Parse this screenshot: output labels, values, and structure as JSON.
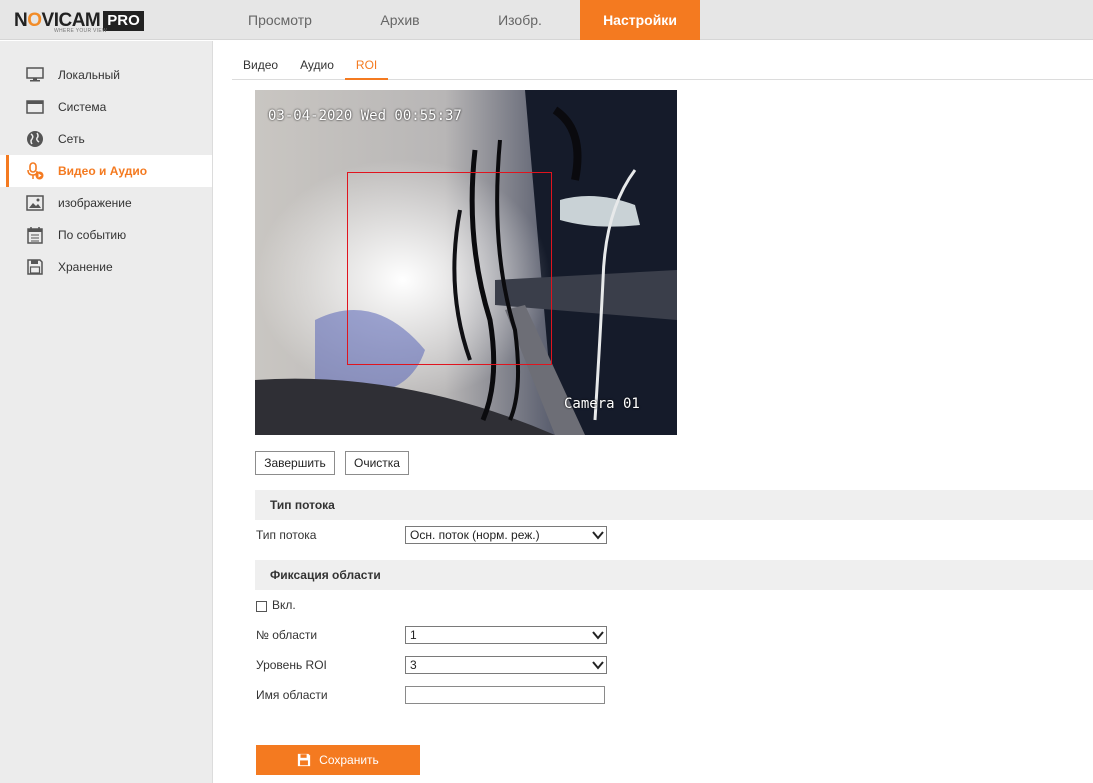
{
  "header": {
    "logo": {
      "part1": "N",
      "part2": "O",
      "part3": "VICAM",
      "pro": "PRO",
      "tagline": "WHERE YOUR VIEW"
    },
    "nav": [
      {
        "label": "Просмотр",
        "active": false
      },
      {
        "label": "Архив",
        "active": false
      },
      {
        "label": "Изобр.",
        "active": false
      },
      {
        "label": "Настройки",
        "active": true
      }
    ],
    "accent_color": "#f47a20"
  },
  "sidebar": {
    "items": [
      {
        "label": "Локальный",
        "icon": "monitor-icon"
      },
      {
        "label": "Система",
        "icon": "window-icon"
      },
      {
        "label": "Сеть",
        "icon": "globe-icon"
      },
      {
        "label": "Видео и Аудио",
        "icon": "mic-camera-icon",
        "active": true
      },
      {
        "label": "изображение",
        "icon": "image-icon"
      },
      {
        "label": "По событию",
        "icon": "calendar-icon"
      },
      {
        "label": "Хранение",
        "icon": "floppy-icon"
      }
    ]
  },
  "tabs": [
    {
      "label": "Видео",
      "active": false
    },
    {
      "label": "Аудио",
      "active": false
    },
    {
      "label": "ROI",
      "active": true
    }
  ],
  "video": {
    "osd_date": "03-04-2020 Wed 00:55:37",
    "osd_camera": "Camera 01"
  },
  "buttons": {
    "finish": "Завершить",
    "clear": "Очистка",
    "save": "Сохранить"
  },
  "stream_section": {
    "title": "Тип потока",
    "field_label": "Тип потока",
    "value": "Осн. поток (норм. реж.)"
  },
  "region_section": {
    "title": "Фиксация области",
    "enable_label": "Вкл.",
    "enable_checked": false,
    "region_no_label": "№ области",
    "region_no_value": "1",
    "roi_level_label": "Уровень ROI",
    "roi_level_value": "3",
    "region_name_label": "Имя области",
    "region_name_value": ""
  }
}
